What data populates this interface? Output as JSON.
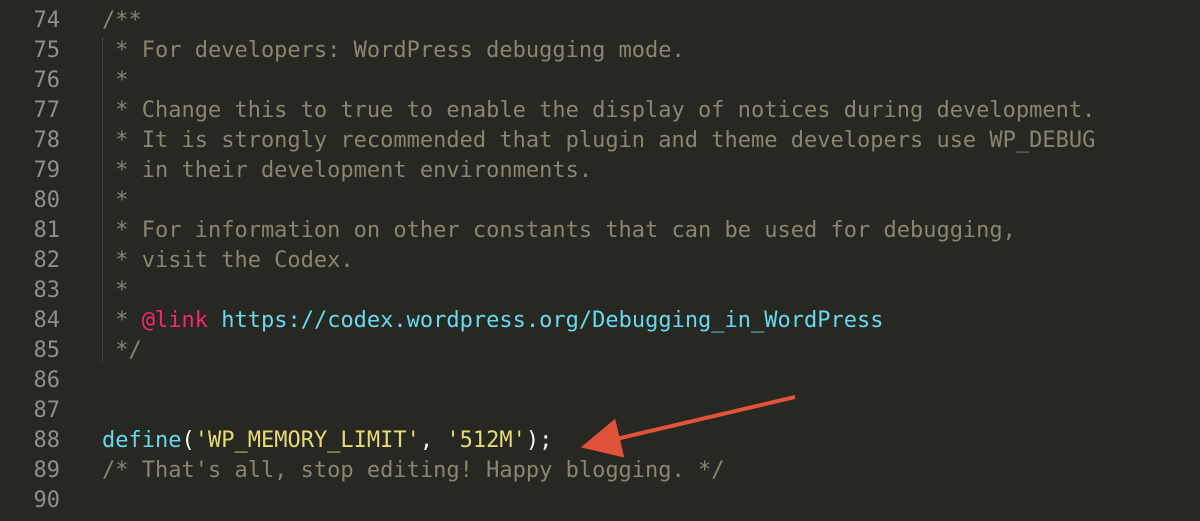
{
  "editor": {
    "lines": [
      {
        "num": "74",
        "parts": [
          {
            "t": "/**",
            "c": "comment"
          }
        ]
      },
      {
        "num": "75",
        "parts": [
          {
            "t": " * For developers: WordPress debugging mode.",
            "c": "comment"
          }
        ]
      },
      {
        "num": "76",
        "parts": [
          {
            "t": " *",
            "c": "comment"
          }
        ]
      },
      {
        "num": "77",
        "parts": [
          {
            "t": " * Change this to true to enable the display of notices during development.",
            "c": "comment"
          }
        ]
      },
      {
        "num": "78",
        "parts": [
          {
            "t": " * It is strongly recommended that plugin and theme developers use WP_DEBUG",
            "c": "comment"
          }
        ]
      },
      {
        "num": "79",
        "parts": [
          {
            "t": " * in their development environments.",
            "c": "comment"
          }
        ]
      },
      {
        "num": "80",
        "parts": [
          {
            "t": " *",
            "c": "comment"
          }
        ]
      },
      {
        "num": "81",
        "parts": [
          {
            "t": " * For information on other constants that can be used for debugging,",
            "c": "comment"
          }
        ]
      },
      {
        "num": "82",
        "parts": [
          {
            "t": " * visit the Codex.",
            "c": "comment"
          }
        ]
      },
      {
        "num": "83",
        "parts": [
          {
            "t": " *",
            "c": "comment"
          }
        ]
      },
      {
        "num": "84",
        "parts": [
          {
            "t": " * ",
            "c": "comment"
          },
          {
            "t": "@link",
            "c": "tag"
          },
          {
            "t": " ",
            "c": "comment"
          },
          {
            "t": "https://codex.wordpress.org/Debugging_in_WordPress",
            "c": "url"
          }
        ]
      },
      {
        "num": "85",
        "parts": [
          {
            "t": " */",
            "c": "comment"
          }
        ]
      },
      {
        "num": "86",
        "parts": []
      },
      {
        "num": "87",
        "parts": []
      },
      {
        "num": "88",
        "parts": [
          {
            "t": "define",
            "c": "fn"
          },
          {
            "t": "(",
            "c": "punct"
          },
          {
            "t": "'WP_MEMORY_LIMIT'",
            "c": "str"
          },
          {
            "t": ", ",
            "c": "punct"
          },
          {
            "t": "'512M'",
            "c": "str"
          },
          {
            "t": ");",
            "c": "punct"
          }
        ]
      },
      {
        "num": "89",
        "parts": [
          {
            "t": "/* That's all, stop editing! Happy blogging. */",
            "c": "comment"
          }
        ]
      },
      {
        "num": "90",
        "parts": []
      }
    ]
  },
  "annotation": {
    "arrow_color": "#e0533a",
    "target_line": "88"
  }
}
